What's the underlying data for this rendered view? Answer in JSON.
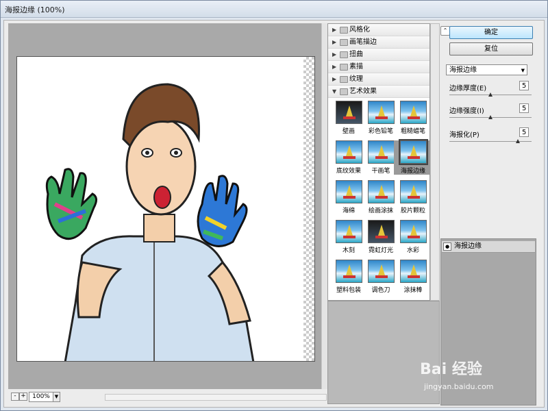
{
  "window": {
    "title": "海报边缘 (100%)"
  },
  "zoom": {
    "minus": "-",
    "plus": "+",
    "value": "100%"
  },
  "filters": {
    "categories": [
      {
        "label": "风格化",
        "expanded": false
      },
      {
        "label": "画笔描边",
        "expanded": false
      },
      {
        "label": "扭曲",
        "expanded": false
      },
      {
        "label": "素描",
        "expanded": false
      },
      {
        "label": "纹理",
        "expanded": false
      },
      {
        "label": "艺术效果",
        "expanded": true
      }
    ],
    "thumbs": [
      "壁画",
      "彩色铅笔",
      "粗糙蜡笔",
      "底纹效果",
      "干画笔",
      "海报边缘",
      "海绵",
      "绘画涂抹",
      "胶片颗粒",
      "木刻",
      "霓虹灯光",
      "水彩",
      "塑料包装",
      "调色刀",
      "涂抹棒"
    ],
    "selected": "海报边缘"
  },
  "buttons": {
    "ok": "确定",
    "reset": "复位"
  },
  "filter_select": {
    "value": "海报边缘"
  },
  "params": [
    {
      "label": "边缘厚度(E)",
      "value": "5",
      "level": 0.5
    },
    {
      "label": "边缘强度(I)",
      "value": "5",
      "level": 0.5
    },
    {
      "label": "海报化(P)",
      "value": "5",
      "level": 0.83
    }
  ],
  "effects_layer": {
    "label": "海报边缘"
  },
  "watermark": {
    "brand": "Bai 经验",
    "url": "jingyan.baidu.com"
  }
}
